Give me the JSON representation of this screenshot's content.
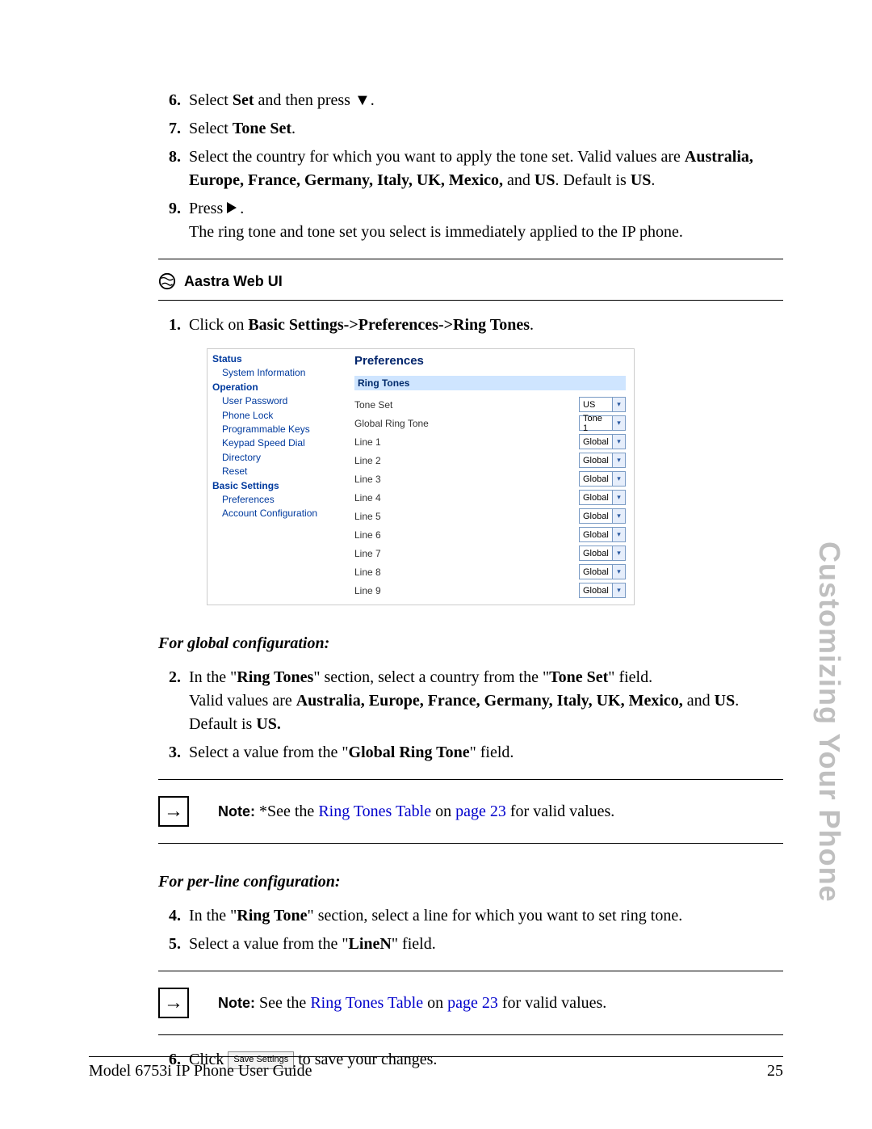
{
  "sidetab": "Customizing Your Phone",
  "steps_top": [
    {
      "n": "6.",
      "pre": "Select ",
      "b1": "Set",
      "mid": " and then press ",
      "tail": "."
    },
    {
      "n": "7.",
      "pre": "Select ",
      "b1": "Tone Set",
      "tail": "."
    },
    {
      "n": "8.",
      "pre": "Select the country for which you want to apply the tone set. Valid values are ",
      "countries": "Australia, Europe, France, Germany, Italy, UK, Mexico, ",
      "and": "and ",
      "us": "US",
      "mid2": ". Default is ",
      "us2": "US",
      "tail": "."
    },
    {
      "n": "9.",
      "pre": "Press ",
      "tail": ".",
      "line2": "The ring tone and tone set you select is immediately applied to the IP phone."
    }
  ],
  "webui_label": "Aastra Web UI",
  "step1": {
    "n": "1.",
    "pre": "Click on ",
    "b": "Basic Settings->Preferences->Ring Tones",
    "tail": "."
  },
  "ui": {
    "side": {
      "status": "Status",
      "sysinfo": "System Information",
      "operation": "Operation",
      "items_op": [
        "User Password",
        "Phone Lock",
        "Programmable Keys",
        "Keypad Speed Dial",
        "Directory",
        "Reset"
      ],
      "basic": "Basic Settings",
      "items_bs": [
        "Preferences",
        "Account Configuration"
      ]
    },
    "title": "Preferences",
    "band": "Ring Tones",
    "rows": [
      {
        "lbl": "Tone Set",
        "val": "US"
      },
      {
        "lbl": "Global Ring Tone",
        "val": "Tone 1"
      },
      {
        "lbl": "Line 1",
        "val": "Global"
      },
      {
        "lbl": "Line 2",
        "val": "Global"
      },
      {
        "lbl": "Line 3",
        "val": "Global"
      },
      {
        "lbl": "Line 4",
        "val": "Global"
      },
      {
        "lbl": "Line 5",
        "val": "Global"
      },
      {
        "lbl": "Line 6",
        "val": "Global"
      },
      {
        "lbl": "Line 7",
        "val": "Global"
      },
      {
        "lbl": "Line 8",
        "val": "Global"
      },
      {
        "lbl": "Line 9",
        "val": "Global"
      }
    ]
  },
  "sub_global": "For global configuration:",
  "step2": {
    "n": "2.",
    "pre": "In the \"",
    "b1": "Ring Tones",
    "mid": "\" section, select a country from the \"",
    "b2": "Tone Set",
    "mid2": "\" field.",
    "line2a": "Valid values are ",
    "countries": "Australia, Europe, France, Germany, Italy, UK, Mexico, ",
    "and": "and ",
    "us": "US",
    "line2b": ". Default is ",
    "us2": "US."
  },
  "step3": {
    "n": "3.",
    "pre": "Select a value from the \"",
    "b": "Global Ring Tone",
    "tail": "\" field."
  },
  "note1": {
    "b": "Note: ",
    "star": "*See the ",
    "link1": "Ring Tones Table",
    "mid": " on ",
    "link2": "page 23",
    "tail": " for valid values."
  },
  "sub_perline": "For per-line configuration:",
  "step4": {
    "n": "4.",
    "pre": "In the \"",
    "b": "Ring Tone",
    "tail": "\" section, select a line for which you want to set ring tone."
  },
  "step5": {
    "n": "5.",
    "pre": "Select a value from the \"",
    "b": "LineN",
    "tail": "\" field."
  },
  "note2": {
    "b": "Note: ",
    "pre": "See the ",
    "link1": "Ring Tones Table",
    "mid": " on ",
    "link2": "page 23",
    "tail": " for valid values."
  },
  "step6": {
    "n": "6.",
    "pre": "Click ",
    "btn": "Save Settings",
    "tail": " to save your changes."
  },
  "footer": {
    "left": "Model 6753i IP Phone User Guide",
    "right": "25"
  }
}
